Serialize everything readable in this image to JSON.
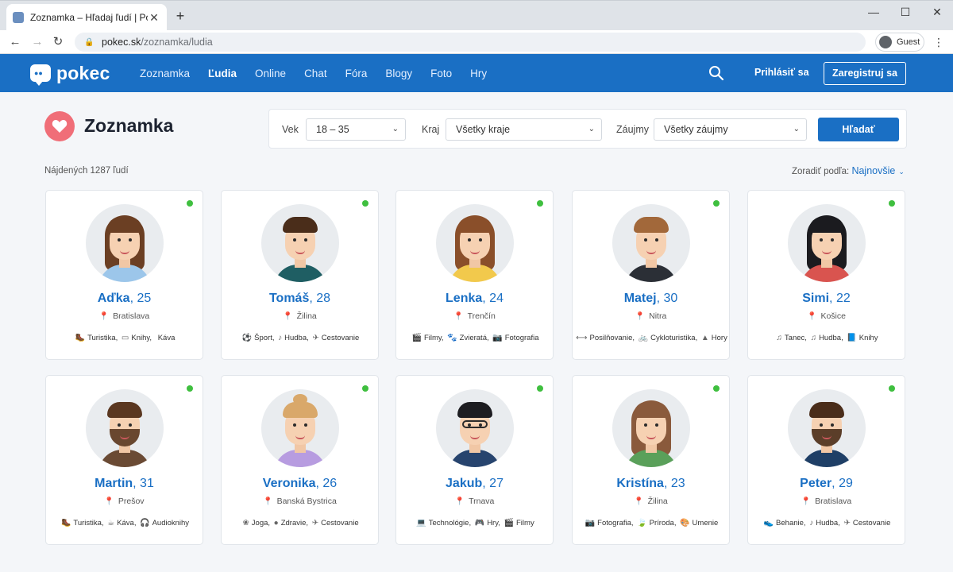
{
  "browser": {
    "tab_title": "Zoznamka – Hľadaj ľudí | Pokec.sk",
    "url_host": "pokec.sk",
    "url_path": "/zoznamka/ludia",
    "profile_label": "Guest"
  },
  "site": {
    "logo": "pokec",
    "nav": [
      "Zoznamka",
      "Ľudia",
      "Online",
      "Chat",
      "Fóra",
      "Blogy",
      "Foto",
      "Hry"
    ],
    "active_nav": "Ľudia",
    "login": "Prihlásiť sa",
    "register": "Zaregistruj sa"
  },
  "page": {
    "title": "Zoznamka",
    "found": "Nájdených 1287 ľudí",
    "sort_label": "Zoradiť podľa:",
    "sort_value": "Najnovšie"
  },
  "filters": {
    "age_label": "Vek",
    "age_value": "18 – 35",
    "region_label": "Kraj",
    "region_value": "Všetky kraje",
    "interest_label": "Záujmy",
    "interest_value": "Všetky záujmy",
    "search_button": "Hľadať"
  },
  "colors": {
    "brand": "#1a6fc4",
    "online": "#3fbf3f",
    "heart": "#f06e78"
  },
  "people": [
    {
      "name": "Aďka",
      "age": "25",
      "city": "Bratislava",
      "online": true,
      "tags": [
        {
          "icon": "hiking-icon",
          "glyph": "🥾",
          "label": "Turistika"
        },
        {
          "icon": "book-icon",
          "glyph": "▭",
          "label": "Knihy"
        },
        {
          "icon": "coffee-icon",
          "glyph": "",
          "label": "Káva"
        }
      ],
      "avatar": {
        "hair": "#6b3f23",
        "shirt": "#9cc6ea",
        "long": true
      }
    },
    {
      "name": "Tomáš",
      "age": "28",
      "city": "Žilina",
      "online": true,
      "tags": [
        {
          "icon": "soccer-icon",
          "glyph": "⚽",
          "label": "Šport"
        },
        {
          "icon": "music-icon",
          "glyph": "♪",
          "label": "Hudba"
        },
        {
          "icon": "plane-icon",
          "glyph": "✈",
          "label": "Cestovanie"
        }
      ],
      "avatar": {
        "hair": "#4a2d1a",
        "shirt": "#1f5e63",
        "long": false
      }
    },
    {
      "name": "Lenka",
      "age": "24",
      "city": "Trenčín",
      "online": true,
      "tags": [
        {
          "icon": "film-icon",
          "glyph": "🎬",
          "label": "Filmy"
        },
        {
          "icon": "paw-icon",
          "glyph": "🐾",
          "label": "Zvieratá"
        },
        {
          "icon": "camera-icon",
          "glyph": "📷",
          "label": "Fotografia"
        }
      ],
      "avatar": {
        "hair": "#8a4f2a",
        "shirt": "#f2c94c",
        "long": true
      }
    },
    {
      "name": "Matej",
      "age": "30",
      "city": "Nitra",
      "online": true,
      "tags": [
        {
          "icon": "dumbbell-icon",
          "glyph": "⟷",
          "label": "Posilňovanie"
        },
        {
          "icon": "bike-icon",
          "glyph": "🚲",
          "label": "Cykloturistika"
        },
        {
          "icon": "mountain-icon",
          "glyph": "▲",
          "label": "Hory"
        }
      ],
      "avatar": {
        "hair": "#a2683a",
        "shirt": "#2b2f36",
        "long": false
      }
    },
    {
      "name": "Simi",
      "age": "22",
      "city": "Košice",
      "online": true,
      "tags": [
        {
          "icon": "dance-icon",
          "glyph": "♫",
          "label": "Tanec"
        },
        {
          "icon": "music-icon",
          "glyph": "♫",
          "label": "Hudba"
        },
        {
          "icon": "book-icon",
          "glyph": "📘",
          "label": "Knihy"
        }
      ],
      "avatar": {
        "hair": "#1b1b1f",
        "shirt": "#d9544f",
        "long": true
      }
    },
    {
      "name": "Martin",
      "age": "31",
      "city": "Prešov",
      "online": true,
      "tags": [
        {
          "icon": "hiking-icon",
          "glyph": "🥾",
          "label": "Turistika"
        },
        {
          "icon": "coffee-icon",
          "glyph": "☕",
          "label": "Káva"
        },
        {
          "icon": "headphones-icon",
          "glyph": "🎧",
          "label": "Audioknihy"
        }
      ],
      "avatar": {
        "hair": "#5a3720",
        "shirt": "#6a4a34",
        "long": false,
        "beard": true
      }
    },
    {
      "name": "Veronika",
      "age": "26",
      "city": "Banská Bystrica",
      "online": true,
      "tags": [
        {
          "icon": "lotus-icon",
          "glyph": "❀",
          "label": "Joga"
        },
        {
          "icon": "apple-icon",
          "glyph": "●",
          "label": "Zdravie"
        },
        {
          "icon": "plane-icon",
          "glyph": "✈",
          "label": "Cestovanie"
        }
      ],
      "avatar": {
        "hair": "#d9a86a",
        "shirt": "#b79ce0",
        "long": false,
        "bun": true
      }
    },
    {
      "name": "Jakub",
      "age": "27",
      "city": "Trnava",
      "online": true,
      "tags": [
        {
          "icon": "laptop-icon",
          "glyph": "💻",
          "label": "Technológie"
        },
        {
          "icon": "gamepad-icon",
          "glyph": "🎮",
          "label": "Hry"
        },
        {
          "icon": "film-icon",
          "glyph": "🎬",
          "label": "Filmy"
        }
      ],
      "avatar": {
        "hair": "#1d1d21",
        "shirt": "#27446e",
        "long": false,
        "glasses": true
      }
    },
    {
      "name": "Kristína",
      "age": "23",
      "city": "Žilina",
      "online": true,
      "tags": [
        {
          "icon": "camera-icon",
          "glyph": "📷",
          "label": "Fotografia"
        },
        {
          "icon": "leaf-icon",
          "glyph": "🍃",
          "label": "Príroda"
        },
        {
          "icon": "palette-icon",
          "glyph": "🎨",
          "label": "Umenie"
        }
      ],
      "avatar": {
        "hair": "#8a5a3c",
        "shirt": "#5aa05a",
        "long": true
      }
    },
    {
      "name": "Peter",
      "age": "29",
      "city": "Bratislava",
      "online": true,
      "tags": [
        {
          "icon": "running-icon",
          "glyph": "👟",
          "label": "Behanie"
        },
        {
          "icon": "music-icon",
          "glyph": "♪",
          "label": "Hudba"
        },
        {
          "icon": "plane-icon",
          "glyph": "✈",
          "label": "Cestovanie"
        }
      ],
      "avatar": {
        "hair": "#4a2d1a",
        "shirt": "#1f3f66",
        "long": false,
        "beard": true
      }
    }
  ]
}
